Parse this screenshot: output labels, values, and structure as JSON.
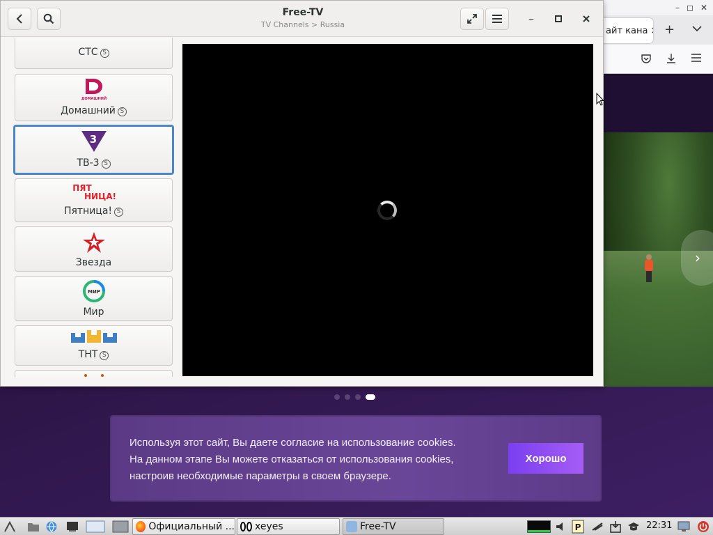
{
  "app": {
    "title": "Free-TV",
    "subtitle": "TV Channels > Russia"
  },
  "icons": {
    "back": "‹",
    "search": "search-icon",
    "fullscreen": "⤢",
    "menu": "☰",
    "minimize": "–",
    "maximize": "◻",
    "close": "✕"
  },
  "channels": [
    {
      "name": "СТС",
      "badge": "S"
    },
    {
      "name": "Домашний",
      "badge": "S"
    },
    {
      "name": "ТВ-3",
      "badge": "S",
      "selected": true
    },
    {
      "name": "Пятница!",
      "badge": "S"
    },
    {
      "name": "Звезда"
    },
    {
      "name": "Мир"
    },
    {
      "name": "ТНТ",
      "badge": "S"
    }
  ],
  "logos": {
    "domashniy_caption": "ДОМАШНИЙ",
    "tv3_digit": "3",
    "pyatnitsa_line1": "ПЯТ",
    "pyatnitsa_line2": "НИЦА!",
    "mir_caption": "МИР"
  },
  "background_browser": {
    "tab_title": "айт кана",
    "tab_close": "×",
    "new_tab": "+",
    "wm_buttons": [
      "–",
      "◻",
      "✕"
    ],
    "slider_pages": 4,
    "slider_active_index": 3,
    "next_arrow": "›"
  },
  "cookie_banner": {
    "line1": "Используя этот сайт, Вы даете согласие на использование cookies.",
    "line2": "На данном этапе Вы можете отказаться от использования cookies,",
    "line3": "настроив необходимые параметры в своем браузере.",
    "button": "Хорошо"
  },
  "taskbar": {
    "tasks": [
      {
        "label": "Официальный ..."
      },
      {
        "label": "xeyes"
      },
      {
        "label": "Free-TV",
        "active": true
      }
    ],
    "clock": "22:31"
  },
  "colors": {
    "selection": "#4a86c8",
    "cookie_button": "#8b4cf2",
    "banner_bg": "#603d8c"
  }
}
